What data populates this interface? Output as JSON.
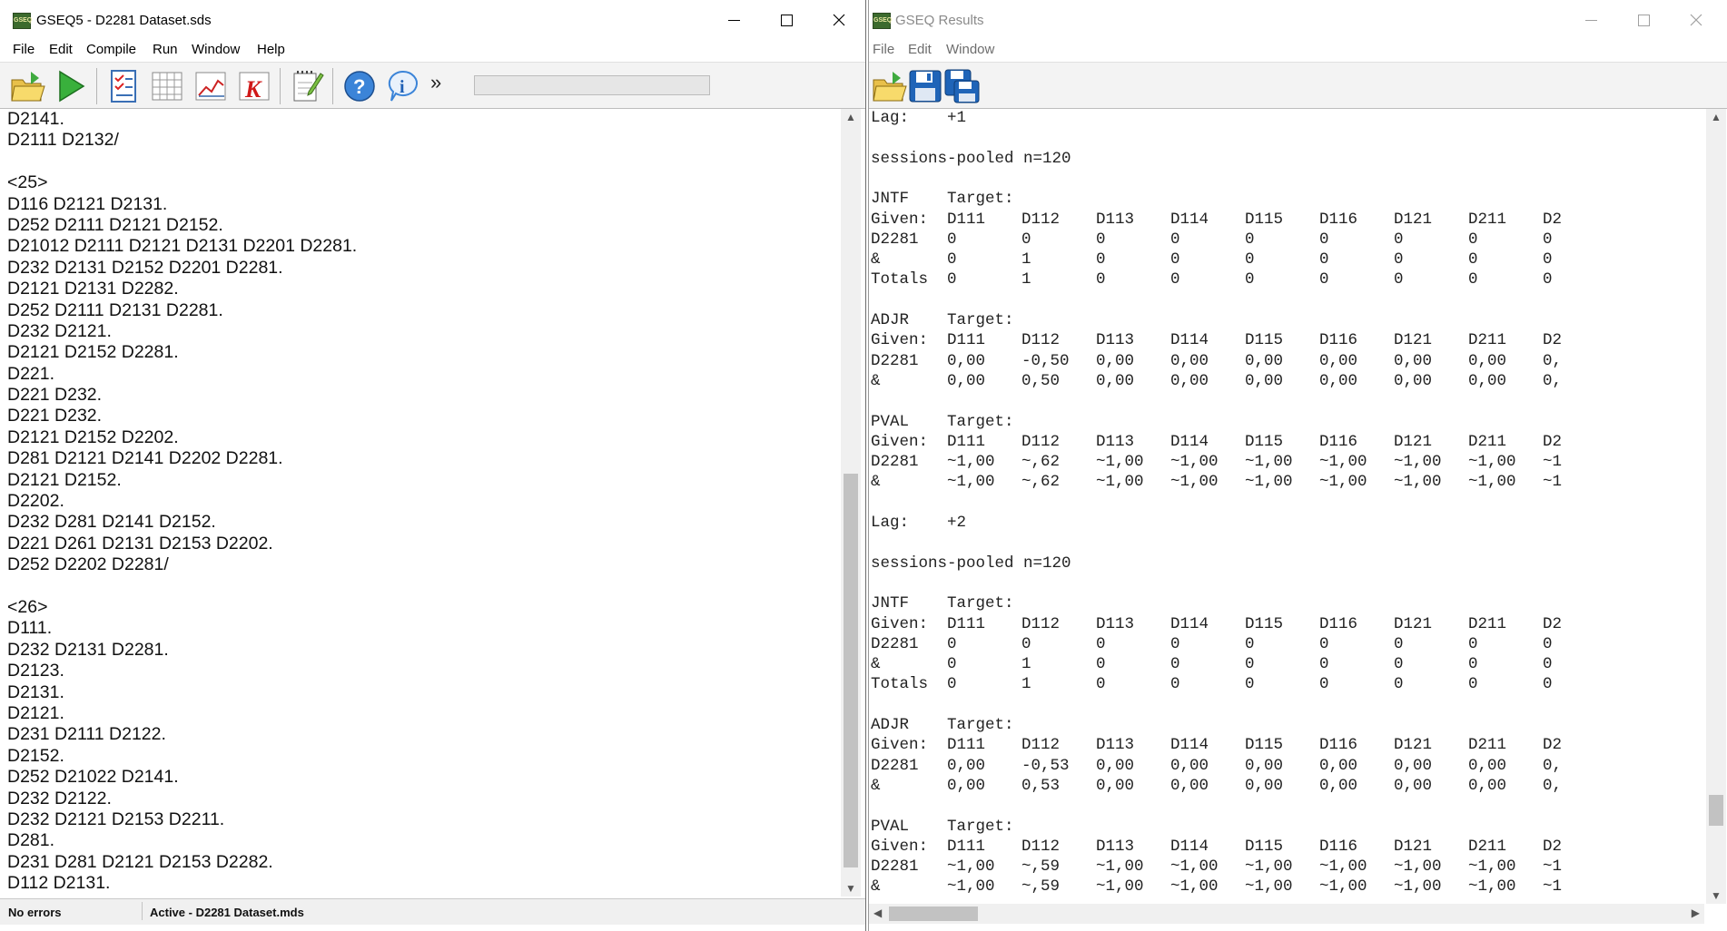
{
  "left_window": {
    "title": "GSEQ5 - D2281 Dataset.sds",
    "icon_label": "GSEQ",
    "menu": [
      "File",
      "Edit",
      "Compile",
      "Run",
      "Window",
      "Help"
    ],
    "toolbar": {
      "icons": [
        "open-folder-icon",
        "run-icon",
        "checklist-icon",
        "grid-table-icon",
        "line-chart-icon",
        "k-icon",
        "notepad-icon",
        "help-icon",
        "info-icon"
      ],
      "overflow": "»"
    },
    "editor_lines": [
      "D2141.",
      "D2111 D2132/",
      "",
      "<25>",
      "D116 D2121 D2131.",
      "D252 D2111 D2121 D2152.",
      "D21012 D2111 D2121 D2131 D2201 D2281.",
      "D232 D2131 D2152 D2201 D2281.",
      "D2121 D2131 D2282.",
      "D252 D2111 D2131 D2281.",
      "D232 D2121.",
      "D2121 D2152 D2281.",
      "D221.",
      "D221 D232.",
      "D221 D232.",
      "D2121 D2152 D2202.",
      "D281 D2121 D2141 D2202 D2281.",
      "D2121 D2152.",
      "D2202.",
      "D232 D281 D2141 D2152.",
      "D221 D261 D2131 D2153 D2202.",
      "D252 D2202 D2281/",
      "",
      "<26>",
      "D111.",
      "D232 D2131 D2281.",
      "D2123.",
      "D2131.",
      "D2121.",
      "D231 D2111 D2122.",
      "D2152.",
      "D252 D21022 D2141.",
      "D232 D2122.",
      "D232 D2121 D2153 D2211.",
      "D281.",
      "D231 D281 D2121 D2153 D2282.",
      "D112 D2131."
    ],
    "status": {
      "left": "No errors",
      "right": "Active - D2281 Dataset.mds"
    }
  },
  "right_window": {
    "title": "GSEQ Results",
    "icon_label": "GSEQ",
    "menu": [
      "File",
      "Edit",
      "Window"
    ],
    "toolbar": {
      "icons": [
        "open-folder-icon",
        "save-icon",
        "save-all-icon"
      ]
    },
    "result_lines": [
      [
        "Lag:",
        "+1"
      ],
      [],
      [
        "sessions-pooled n=120"
      ],
      [],
      [
        "JNTF",
        "Target:"
      ],
      [
        "Given:",
        "D111",
        "D112",
        "D113",
        "D114",
        "D115",
        "D116",
        "D121",
        "D211",
        "D2"
      ],
      [
        "D2281",
        "0",
        "0",
        "0",
        "0",
        "0",
        "0",
        "0",
        "0",
        "0"
      ],
      [
        "&",
        "0",
        "1",
        "0",
        "0",
        "0",
        "0",
        "0",
        "0",
        "0"
      ],
      [
        "Totals",
        "0",
        "1",
        "0",
        "0",
        "0",
        "0",
        "0",
        "0",
        "0"
      ],
      [],
      [
        "ADJR",
        "Target:"
      ],
      [
        "Given:",
        "D111",
        "D112",
        "D113",
        "D114",
        "D115",
        "D116",
        "D121",
        "D211",
        "D2"
      ],
      [
        "D2281",
        "0,00",
        "-0,50",
        "0,00",
        "0,00",
        "0,00",
        "0,00",
        "0,00",
        "0,00",
        "0,"
      ],
      [
        "&",
        "0,00",
        "0,50",
        "0,00",
        "0,00",
        "0,00",
        "0,00",
        "0,00",
        "0,00",
        "0,"
      ],
      [],
      [
        "PVAL",
        "Target:"
      ],
      [
        "Given:",
        "D111",
        "D112",
        "D113",
        "D114",
        "D115",
        "D116",
        "D121",
        "D211",
        "D2"
      ],
      [
        "D2281",
        "~1,00",
        "~,62",
        "~1,00",
        "~1,00",
        "~1,00",
        "~1,00",
        "~1,00",
        "~1,00",
        "~1"
      ],
      [
        "&",
        "~1,00",
        "~,62",
        "~1,00",
        "~1,00",
        "~1,00",
        "~1,00",
        "~1,00",
        "~1,00",
        "~1"
      ],
      [],
      [
        "Lag:",
        "+2"
      ],
      [],
      [
        "sessions-pooled n=120"
      ],
      [],
      [
        "JNTF",
        "Target:"
      ],
      [
        "Given:",
        "D111",
        "D112",
        "D113",
        "D114",
        "D115",
        "D116",
        "D121",
        "D211",
        "D2"
      ],
      [
        "D2281",
        "0",
        "0",
        "0",
        "0",
        "0",
        "0",
        "0",
        "0",
        "0"
      ],
      [
        "&",
        "0",
        "1",
        "0",
        "0",
        "0",
        "0",
        "0",
        "0",
        "0"
      ],
      [
        "Totals",
        "0",
        "1",
        "0",
        "0",
        "0",
        "0",
        "0",
        "0",
        "0"
      ],
      [],
      [
        "ADJR",
        "Target:"
      ],
      [
        "Given:",
        "D111",
        "D112",
        "D113",
        "D114",
        "D115",
        "D116",
        "D121",
        "D211",
        "D2"
      ],
      [
        "D2281",
        "0,00",
        "-0,53",
        "0,00",
        "0,00",
        "0,00",
        "0,00",
        "0,00",
        "0,00",
        "0,"
      ],
      [
        "&",
        "0,00",
        "0,53",
        "0,00",
        "0,00",
        "0,00",
        "0,00",
        "0,00",
        "0,00",
        "0,"
      ],
      [],
      [
        "PVAL",
        "Target:"
      ],
      [
        "Given:",
        "D111",
        "D112",
        "D113",
        "D114",
        "D115",
        "D116",
        "D121",
        "D211",
        "D2"
      ],
      [
        "D2281",
        "~1,00",
        "~,59",
        "~1,00",
        "~1,00",
        "~1,00",
        "~1,00",
        "~1,00",
        "~1,00",
        "~1"
      ],
      [
        "&",
        "~1,00",
        "~,59",
        "~1,00",
        "~1,00",
        "~1,00",
        "~1,00",
        "~1,00",
        "~1,00",
        "~1"
      ]
    ]
  }
}
